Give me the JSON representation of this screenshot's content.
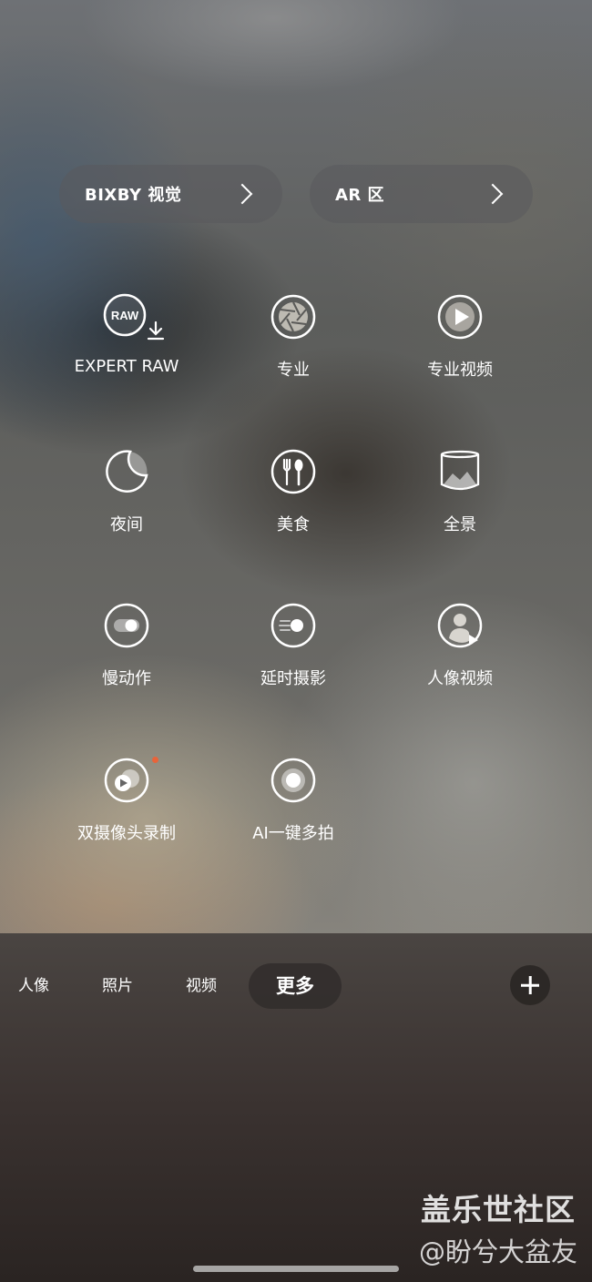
{
  "top_buttons": {
    "bixby": "BIXBY 视觉",
    "ar": "AR 区"
  },
  "modes": [
    {
      "label": "EXPERT RAW",
      "badge": "RAW"
    },
    {
      "label": "专业"
    },
    {
      "label": "专业视频"
    },
    {
      "label": "夜间"
    },
    {
      "label": "美食"
    },
    {
      "label": "全景"
    },
    {
      "label": "慢动作"
    },
    {
      "label": "延时摄影"
    },
    {
      "label": "人像视频"
    },
    {
      "label": "双摄像头录制"
    },
    {
      "label": "AI一键多拍"
    }
  ],
  "bottom_tabs": [
    {
      "label": "人像"
    },
    {
      "label": "照片"
    },
    {
      "label": "视频"
    },
    {
      "label": "更多",
      "active": true
    }
  ],
  "watermark": {
    "site": "盖乐世社区",
    "author": "@盼兮大盆友"
  },
  "colors": {
    "notification_dot": "#e8643a"
  }
}
